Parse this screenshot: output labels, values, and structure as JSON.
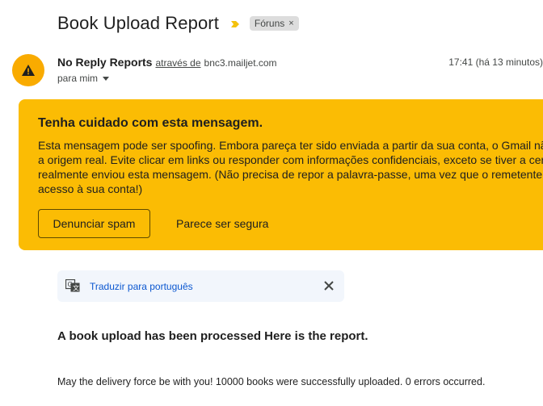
{
  "email": {
    "subject": "Book Upload Report",
    "label": "Fóruns",
    "label_remove": "×",
    "sender": {
      "name": "No Reply Reports",
      "via_text": "através de",
      "via_domain": "bnc3.mailjet.com",
      "timestamp": "17:41 (há 13 minutos)",
      "to": "para mim"
    }
  },
  "warning": {
    "title": "Tenha cuidado com esta mensagem.",
    "lines": [
      "Esta mensagem pode ser spoofing. Embora pareça ter sido enviada a partir da sua conta, o Gmail não conseguiu verificar",
      "a origem real. Evite clicar em links ou responder com informações confidenciais, exceto se tiver a certeza de que",
      "realmente enviou esta mensagem. (Não precisa de repor a palavra-passe, uma vez que o remetente não teve",
      "acesso à sua conta!)"
    ],
    "report_button": "Denunciar spam",
    "safe_button": "Parece ser segura"
  },
  "translate": {
    "link": "Traduzir para português"
  },
  "body": {
    "heading": "A book upload has been processed Here is the report.",
    "text": "May the delivery force be with you! 10000 books were successfully uploaded. 0 errors occurred."
  },
  "colors": {
    "warning_bg": "#fbbc04",
    "avatar_bg": "#f9ab00",
    "link_blue": "#0b57d0",
    "translate_bg": "#f2f6fc"
  }
}
